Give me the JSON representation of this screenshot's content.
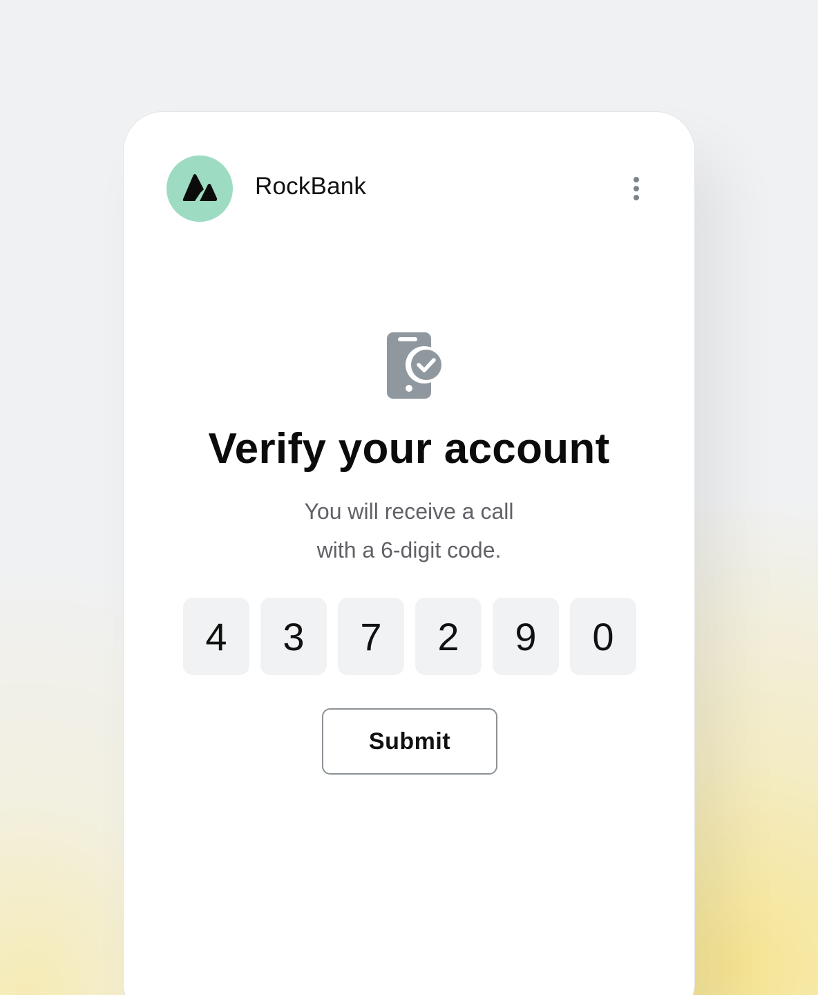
{
  "brand": {
    "name": "RockBank",
    "logo_icon": "mountain-peaks-icon",
    "logo_color": "#9ddcc2"
  },
  "header": {
    "menu_icon": "more-vertical-icon"
  },
  "hero": {
    "icon": "phone-verified-icon",
    "title": "Verify your account",
    "subtitle_line1": "You will receive a call",
    "subtitle_line2": "with a 6-digit code."
  },
  "code": {
    "digits": [
      "4",
      "3",
      "7",
      "2",
      "9",
      "0"
    ]
  },
  "actions": {
    "submit_label": "Submit"
  },
  "colors": {
    "icon_gray": "#8f989f",
    "background": "#f0f1f2",
    "glow": "#f7e48c"
  }
}
